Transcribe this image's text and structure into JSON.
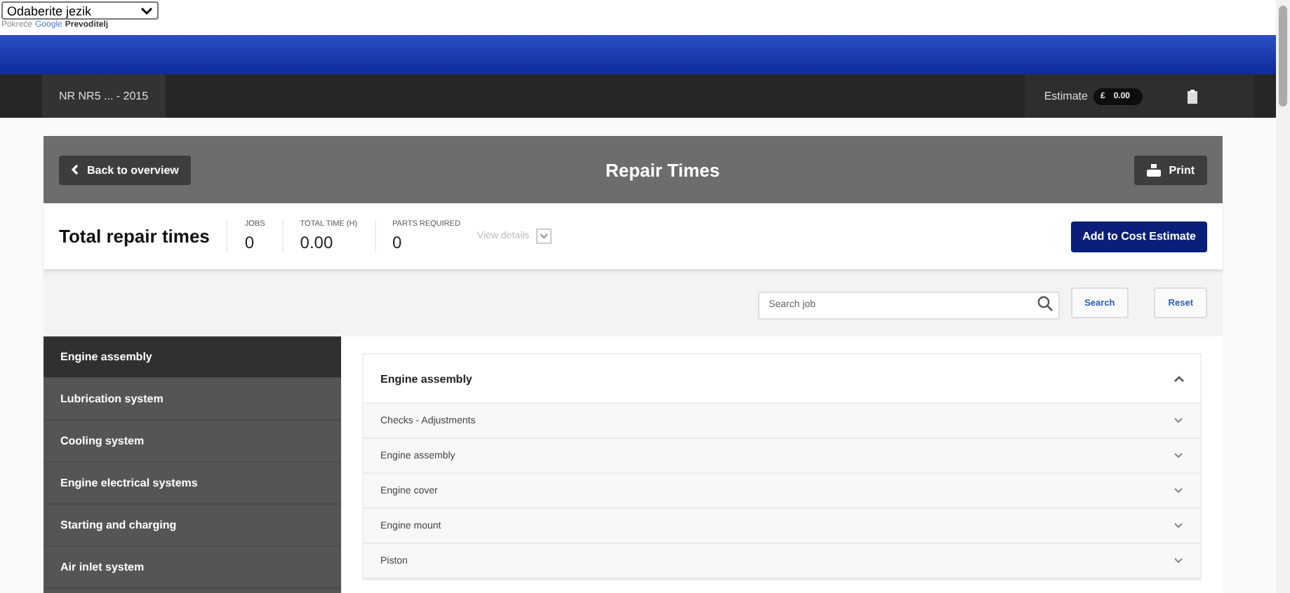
{
  "translate": {
    "select_value": "Odaberite jezik",
    "powered_by": "Pokreće",
    "brand": "Google",
    "product": "Prevoditelj"
  },
  "vehicle_bar": {
    "vehicle": "NR NR5 ... - 2015",
    "estimate_label": "Estimate",
    "currency": "£",
    "estimate_value": "0.00"
  },
  "header": {
    "back": "Back to overview",
    "title": "Repair Times",
    "print": "Print"
  },
  "summary": {
    "title": "Total repair times",
    "stats": [
      {
        "label": "JOBS",
        "value": "0"
      },
      {
        "label": "TOTAL TIME (H)",
        "value": "0.00"
      },
      {
        "label": "PARTS REQUIRED",
        "value": "0"
      }
    ],
    "view_details": "View details",
    "add_button": "Add to Cost Estimate"
  },
  "search": {
    "placeholder": "Search job",
    "search_button": "Search",
    "reset_button": "Reset"
  },
  "sidebar": {
    "items": [
      {
        "label": "Engine assembly",
        "selected": true
      },
      {
        "label": "Lubrication system",
        "selected": false
      },
      {
        "label": "Cooling system",
        "selected": false
      },
      {
        "label": "Engine electrical systems",
        "selected": false
      },
      {
        "label": "Starting and charging",
        "selected": false
      },
      {
        "label": "Air inlet system",
        "selected": false
      }
    ]
  },
  "accordion": {
    "title": "Engine assembly",
    "expanded": true,
    "items": [
      {
        "label": "Checks - Adjustments",
        "expanded": false
      },
      {
        "label": "Engine assembly",
        "expanded": false
      },
      {
        "label": "Engine cover",
        "expanded": false
      },
      {
        "label": "Engine mount",
        "expanded": false
      },
      {
        "label": "Piston",
        "expanded": false
      }
    ]
  }
}
